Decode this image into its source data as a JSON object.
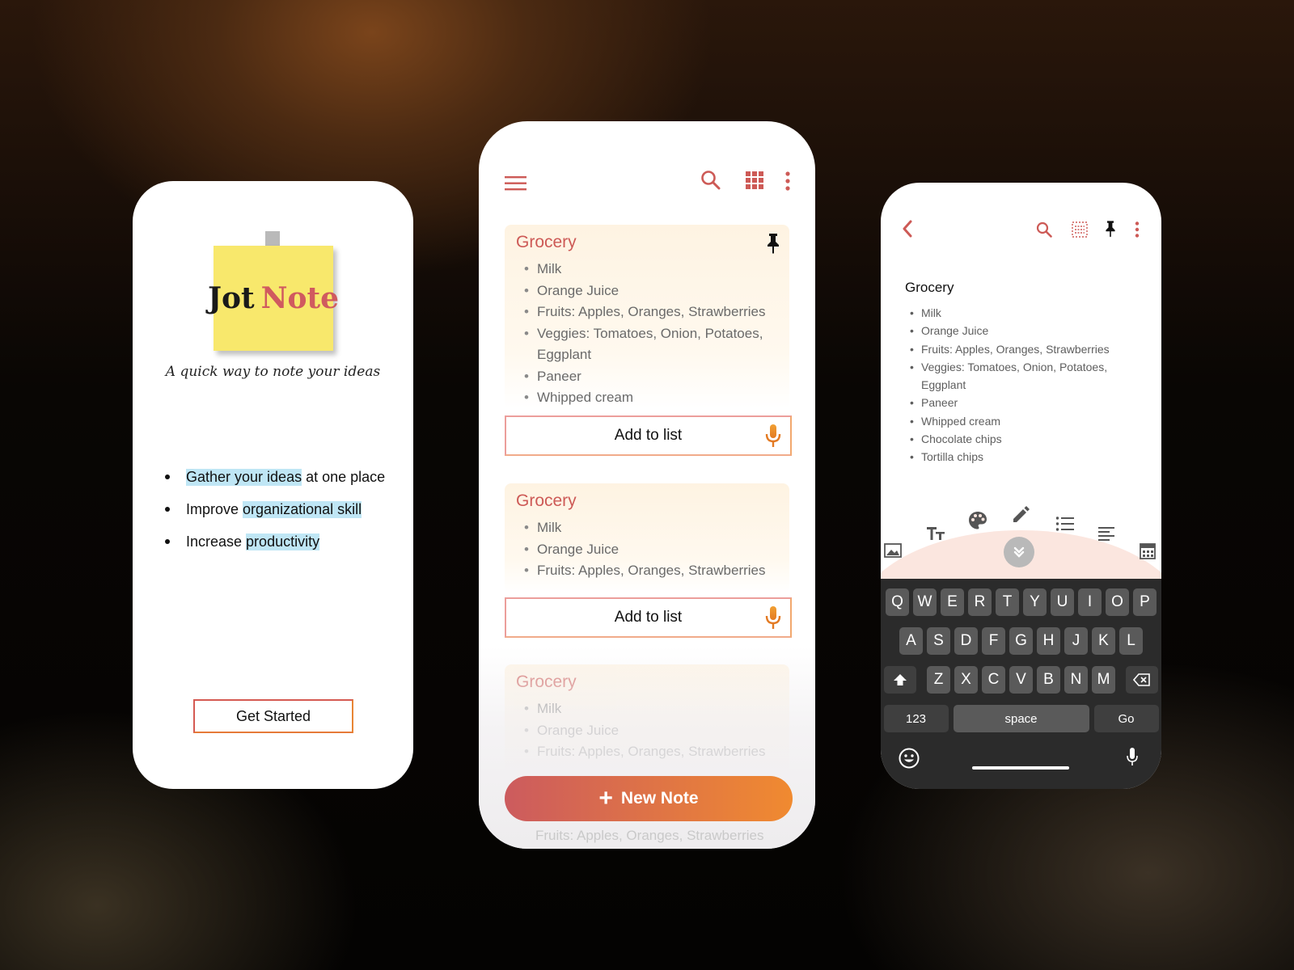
{
  "onboarding": {
    "logo_word1": "Jot",
    "logo_word2": "Note",
    "tagline": "A quick way to note your ideas",
    "bullets": [
      {
        "highlight": "Gather your ideas",
        "rest": " at one place"
      },
      {
        "prefix": "Improve ",
        "highlight": "organizational skill"
      },
      {
        "prefix": "Increase ",
        "highlight": "productivity"
      }
    ],
    "cta_label": "Get Started"
  },
  "list_screen": {
    "icons": [
      "menu-icon",
      "search-icon",
      "grid-view-icon",
      "more-vert-icon",
      "pin-icon",
      "mic-icon"
    ],
    "cards": [
      {
        "title": "Grocery",
        "items": [
          "Milk",
          "Orange Juice",
          "Fruits: Apples, Oranges, Strawberries",
          "Veggies: Tomatoes, Onion, Potatoes,",
          "Eggplant",
          "Paneer",
          "Whipped cream"
        ]
      },
      {
        "title": "Grocery",
        "items": [
          "Milk",
          "Orange Juice",
          "Fruits: Apples, Oranges, Strawberries"
        ]
      },
      {
        "title": "Grocery",
        "items": [
          "Milk",
          "Orange Juice",
          "Fruits: Apples, Oranges, Strawberries"
        ]
      }
    ],
    "add_to_list_label": "Add to list",
    "new_note_label": "New Note",
    "ghost_row": "Fruits: Apples, Oranges, Strawberries"
  },
  "editor": {
    "icons": [
      "back-icon",
      "search-icon",
      "list-view-icon",
      "pin-icon",
      "more-vert-icon",
      "image-icon",
      "text-size-icon",
      "palette-icon",
      "pencil-icon",
      "bullet-list-icon",
      "align-icon",
      "calculator-icon",
      "collapse-icon"
    ],
    "title": "Grocery",
    "items": [
      "Milk",
      "Orange Juice",
      "Fruits: Apples, Oranges, Strawberries",
      "Veggies: Tomatoes, Onion, Potatoes,",
      "Eggplant",
      "Paneer",
      "Whipped cream",
      "Chocolate chips",
      "Tortilla chips"
    ],
    "keyboard": {
      "row1": [
        "Q",
        "W",
        "E",
        "R",
        "T",
        "Y",
        "U",
        "I",
        "O",
        "P"
      ],
      "row2": [
        "A",
        "S",
        "D",
        "F",
        "G",
        "H",
        "J",
        "K",
        "L"
      ],
      "row3": [
        "Z",
        "X",
        "C",
        "V",
        "B",
        "N",
        "M"
      ],
      "numbers": "123",
      "space": "space",
      "go": "Go"
    }
  },
  "colors": {
    "accent_red": "#cd5a56",
    "accent_orange": "#f08a30",
    "sticky_yellow": "#f8e86c",
    "highlight_blue": "#bfe6f5"
  }
}
